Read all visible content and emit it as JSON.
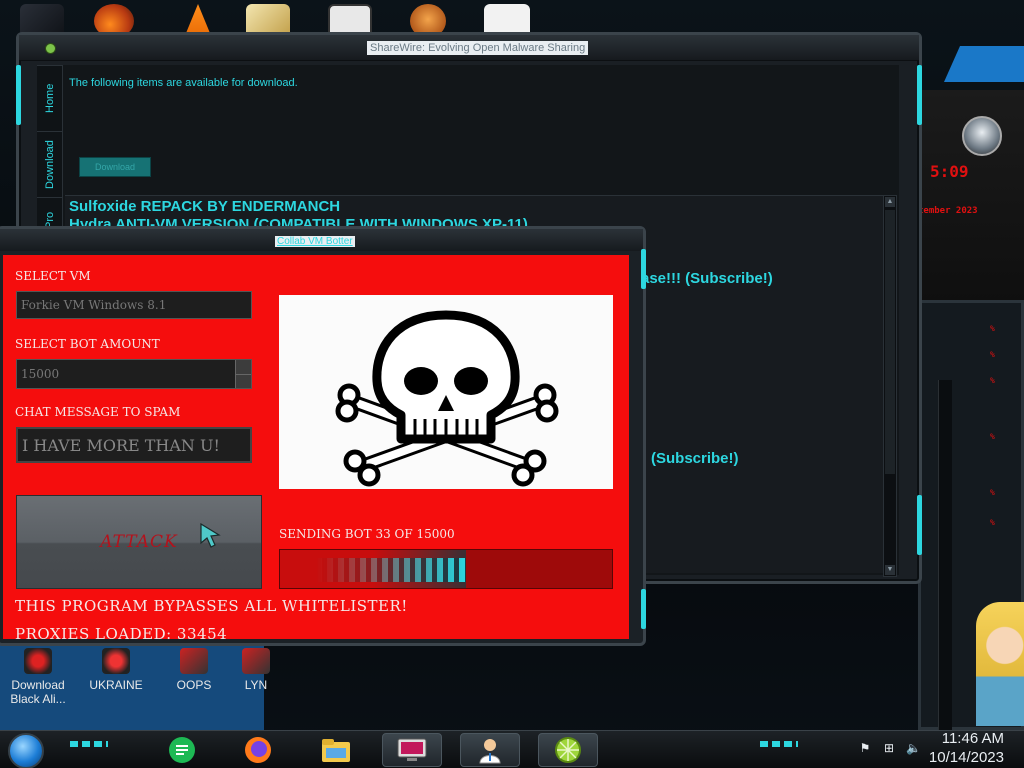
{
  "main_window": {
    "title": "ShareWire: Evolving Open Malware Sharing",
    "tabs": [
      "Home",
      "Download",
      "ShareWire Pro"
    ],
    "available_text": "The following items are available for download.",
    "download_button": "Download",
    "items": [
      "Sulfoxide REPACK BY ENDERMANCH",
      "Hydra ANTI-VM VERSION (COMPATIBLE WITH WINDOWS XP-11)",
      "ase!!! (Subscribe!)",
      "(Subscribe!)"
    ]
  },
  "bot_window": {
    "title": "Collab VM Botter",
    "select_vm_label": "SELECT VM",
    "select_vm_value": "Forkie VM Windows 8.1",
    "bot_amount_label": "SELECT BOT AMOUNT",
    "bot_amount_value": "15000",
    "chat_label": "CHAT MESSAGE TO SPAM",
    "chat_value": "I HAVE MORE THAN U!",
    "attack_button": "ATTACK",
    "sending_text": "SENDING BOT 33 OF 15000",
    "progress": 0.56,
    "bypass_text": "THIS PROGRAM BYPASSES ALL WHITELISTER!",
    "proxies_text": "PROXIES LOADED: 33454"
  },
  "desktop_icons": [
    {
      "label": "Download Black Ali...",
      "icon": "alien-icon"
    },
    {
      "label": "UKRAINE",
      "icon": "ukraine-icon"
    },
    {
      "label": "OOPS",
      "icon": "oops-icon"
    },
    {
      "label": "LYN",
      "icon": "lyn-icon"
    }
  ],
  "widgets": {
    "time_readout": "5:09",
    "date_readout": "tember 2023",
    "percent_labels": [
      "%",
      "%",
      "%",
      "%",
      "%",
      "%"
    ]
  },
  "taskbar": {
    "apps": [
      "notes-icon",
      "firefox-icon",
      "file-explorer-icon",
      "remote-desktop-icon",
      "user-support-icon",
      "lime-icon"
    ],
    "time": "11:46 AM",
    "date": "10/14/2023"
  },
  "colors": {
    "accent_cyan": "#2dd7e0",
    "bot_red": "#f50d0d",
    "attack_text": "#b3121c"
  }
}
